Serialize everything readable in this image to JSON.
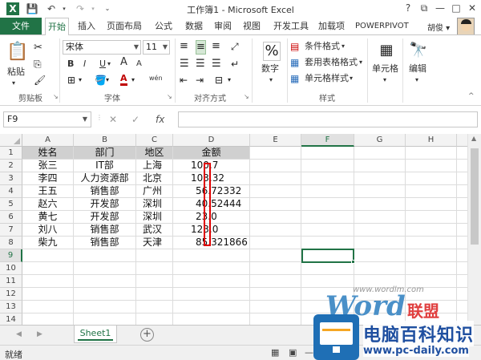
{
  "title_bar": {
    "title": "工作簿1 - Microsoft Excel",
    "help": "?",
    "restore": "⧉",
    "minimize": "—",
    "maximize": "□",
    "close": "✕"
  },
  "ribbon_tabs": {
    "file": "文件",
    "tabs": [
      "开始",
      "插入",
      "页面布局",
      "公式",
      "数据",
      "审阅",
      "视图",
      "开发工具",
      "加载项",
      "POWERPIVOT"
    ],
    "user": "胡俊 ▾"
  },
  "ribbon": {
    "clipboard": {
      "paste": "粘贴",
      "label": "剪贴板"
    },
    "font": {
      "name": "宋体",
      "size": "11",
      "bold": "B",
      "italic": "I",
      "underline": "U",
      "grow": "A",
      "shrink": "A",
      "color_letter": "A",
      "wen": "wén",
      "label": "字体"
    },
    "alignment": {
      "label": "对齐方式"
    },
    "number": {
      "button": "数字"
    },
    "styles": {
      "conditional": "条件格式",
      "table": "套用表格格式",
      "cell": "单元格样式",
      "label": "样式"
    },
    "cells": {
      "button": "单元格"
    },
    "editing": {
      "button": "编辑"
    }
  },
  "formula_bar": {
    "name_box": "F9",
    "cancel": "✕",
    "enter": "✓",
    "fx": "fx",
    "value": ""
  },
  "columns": [
    "A",
    "B",
    "C",
    "D",
    "E",
    "F",
    "G",
    "H"
  ],
  "rows": [
    "1",
    "2",
    "3",
    "4",
    "5",
    "6",
    "7",
    "8",
    "9",
    "10",
    "11",
    "12",
    "13",
    "14"
  ],
  "sheet": {
    "header": [
      "姓名",
      "部门",
      "地区",
      "金额"
    ],
    "rows": [
      [
        "张三",
        "IT部",
        "上海",
        "100.7"
      ],
      [
        "李四",
        "人力资源部",
        "北京",
        "103.32"
      ],
      [
        "王五",
        "销售部",
        "广州",
        "56.72332"
      ],
      [
        "赵六",
        "开发部",
        "深圳",
        "40.52444"
      ],
      [
        "黄七",
        "开发部",
        "深圳",
        "23.0"
      ],
      [
        "刘八",
        "销售部",
        "武汉",
        "123.0"
      ],
      [
        "柴九",
        "销售部",
        "天津",
        "85.321866"
      ]
    ]
  },
  "sheet_tabs": {
    "active": "Sheet1",
    "add": "+"
  },
  "status": {
    "text": "就绪",
    "zoom_minus": "—"
  },
  "watermark": {
    "url": "www.wordlm.com",
    "word": "Word",
    "lm": "联盟"
  },
  "logo": {
    "title": "电脑百科知识",
    "url": "www.pc-daily.com"
  },
  "colors": {
    "accent": "#217346",
    "highlight": "#e00000",
    "header_fill": "#d0d0d0"
  }
}
